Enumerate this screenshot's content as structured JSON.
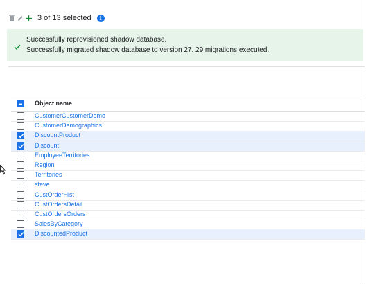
{
  "toolbar": {
    "icons": [
      "delete-icon",
      "edit-icon",
      "add-icon"
    ],
    "selection_text": "3 of 13 selected",
    "info_icon_glyph": "i"
  },
  "alert": {
    "line1": "Successfully reprovisioned shadow database.",
    "line2": "Successfully migrated shadow database to version 27. 29 migrations executed.",
    "color": "#e6f4ea"
  },
  "table": {
    "header": "Object name",
    "rows": [
      {
        "name": "CustomerCustomerDemo",
        "selected": false
      },
      {
        "name": "CustomerDemographics",
        "selected": false
      },
      {
        "name": "DiscountProduct",
        "selected": true
      },
      {
        "name": "Discount",
        "selected": true
      },
      {
        "name": "EmployeeTerritories",
        "selected": false
      },
      {
        "name": "Region",
        "selected": false
      },
      {
        "name": "Territories",
        "selected": false
      },
      {
        "name": "steve",
        "selected": false
      },
      {
        "name": "CustOrderHist",
        "selected": false
      },
      {
        "name": "CustOrdersDetail",
        "selected": false
      },
      {
        "name": "CustOrdersOrders",
        "selected": false
      },
      {
        "name": "SalesByCategory",
        "selected": false
      },
      {
        "name": "DiscountedProduct",
        "selected": true
      }
    ]
  },
  "colors": {
    "accent": "#1a73e8",
    "selected_row": "#e8f0fe",
    "success": "#1e8e3e"
  }
}
